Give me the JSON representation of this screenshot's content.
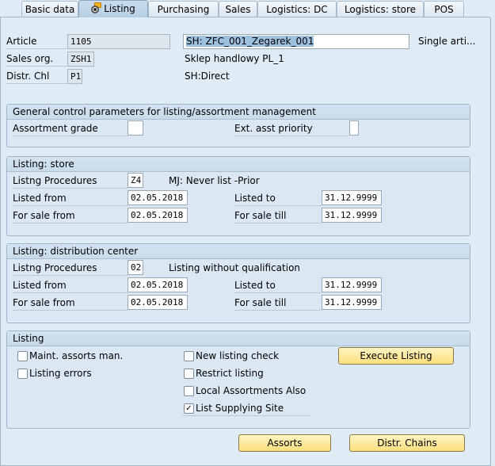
{
  "tabs": [
    {
      "label": "Basic data",
      "active": false
    },
    {
      "label": "Listing",
      "active": true,
      "icon": "listing-status-icon"
    },
    {
      "label": "Purchasing",
      "active": false
    },
    {
      "label": "Sales",
      "active": false
    },
    {
      "label": "Logistics: DC",
      "active": false
    },
    {
      "label": "Logistics: store",
      "active": false
    },
    {
      "label": "POS",
      "active": false
    }
  ],
  "header": {
    "article_label": "Article",
    "article_value": "1105",
    "article_desc": "SH: ZFC_001_Zegarek_001",
    "article_type": "Single arti...",
    "sales_org_label": "Sales org.",
    "sales_org_value": "ZSH1",
    "sales_org_desc": "Sklep handlowy PL_1",
    "distr_chl_label": "Distr. Chl",
    "distr_chl_value": "P1",
    "distr_chl_desc": "SH:Direct"
  },
  "general": {
    "title": "General control parameters for listing/assortment management",
    "assortment_grade_label": "Assortment grade",
    "assortment_grade_value": "",
    "ext_asst_priority_label": "Ext. asst priority",
    "ext_asst_priority_value": ""
  },
  "store": {
    "title": "Listing: store",
    "procedures_label": "Listng Procedures",
    "procedures_value": "Z4",
    "procedures_desc": "MJ: Never list -Prior",
    "listed_from_label": "Listed from",
    "listed_from_value": "02.05.2018",
    "listed_to_label": "Listed to",
    "listed_to_value": "31.12.9999",
    "sale_from_label": "For sale from",
    "sale_from_value": "02.05.2018",
    "sale_till_label": "For sale till",
    "sale_till_value": "31.12.9999"
  },
  "dc": {
    "title": "Listing: distribution center",
    "procedures_label": "Listng Procedures",
    "procedures_value": "02",
    "procedures_desc": "Listing without qualification",
    "listed_from_label": "Listed from",
    "listed_from_value": "02.05.2018",
    "listed_to_label": "Listed to",
    "listed_to_value": "31.12.9999",
    "sale_from_label": "For sale from",
    "sale_from_value": "02.05.2018",
    "sale_till_label": "For sale till",
    "sale_till_value": "31.12.9999"
  },
  "listing": {
    "title": "Listing",
    "checkboxes": [
      {
        "label": "Maint. assorts man.",
        "checked": false
      },
      {
        "label": "Listing errors",
        "checked": false
      },
      {
        "label": "New listing check",
        "checked": false
      },
      {
        "label": "Restrict listing",
        "checked": false
      },
      {
        "label": "Local Assortments Also",
        "checked": false
      },
      {
        "label": "List Supplying Site",
        "checked": true
      }
    ],
    "execute_button": "Execute Listing"
  },
  "footer": {
    "assorts_button": "Assorts",
    "distr_chains_button": "Distr. Chains"
  },
  "check_mark": "✓"
}
